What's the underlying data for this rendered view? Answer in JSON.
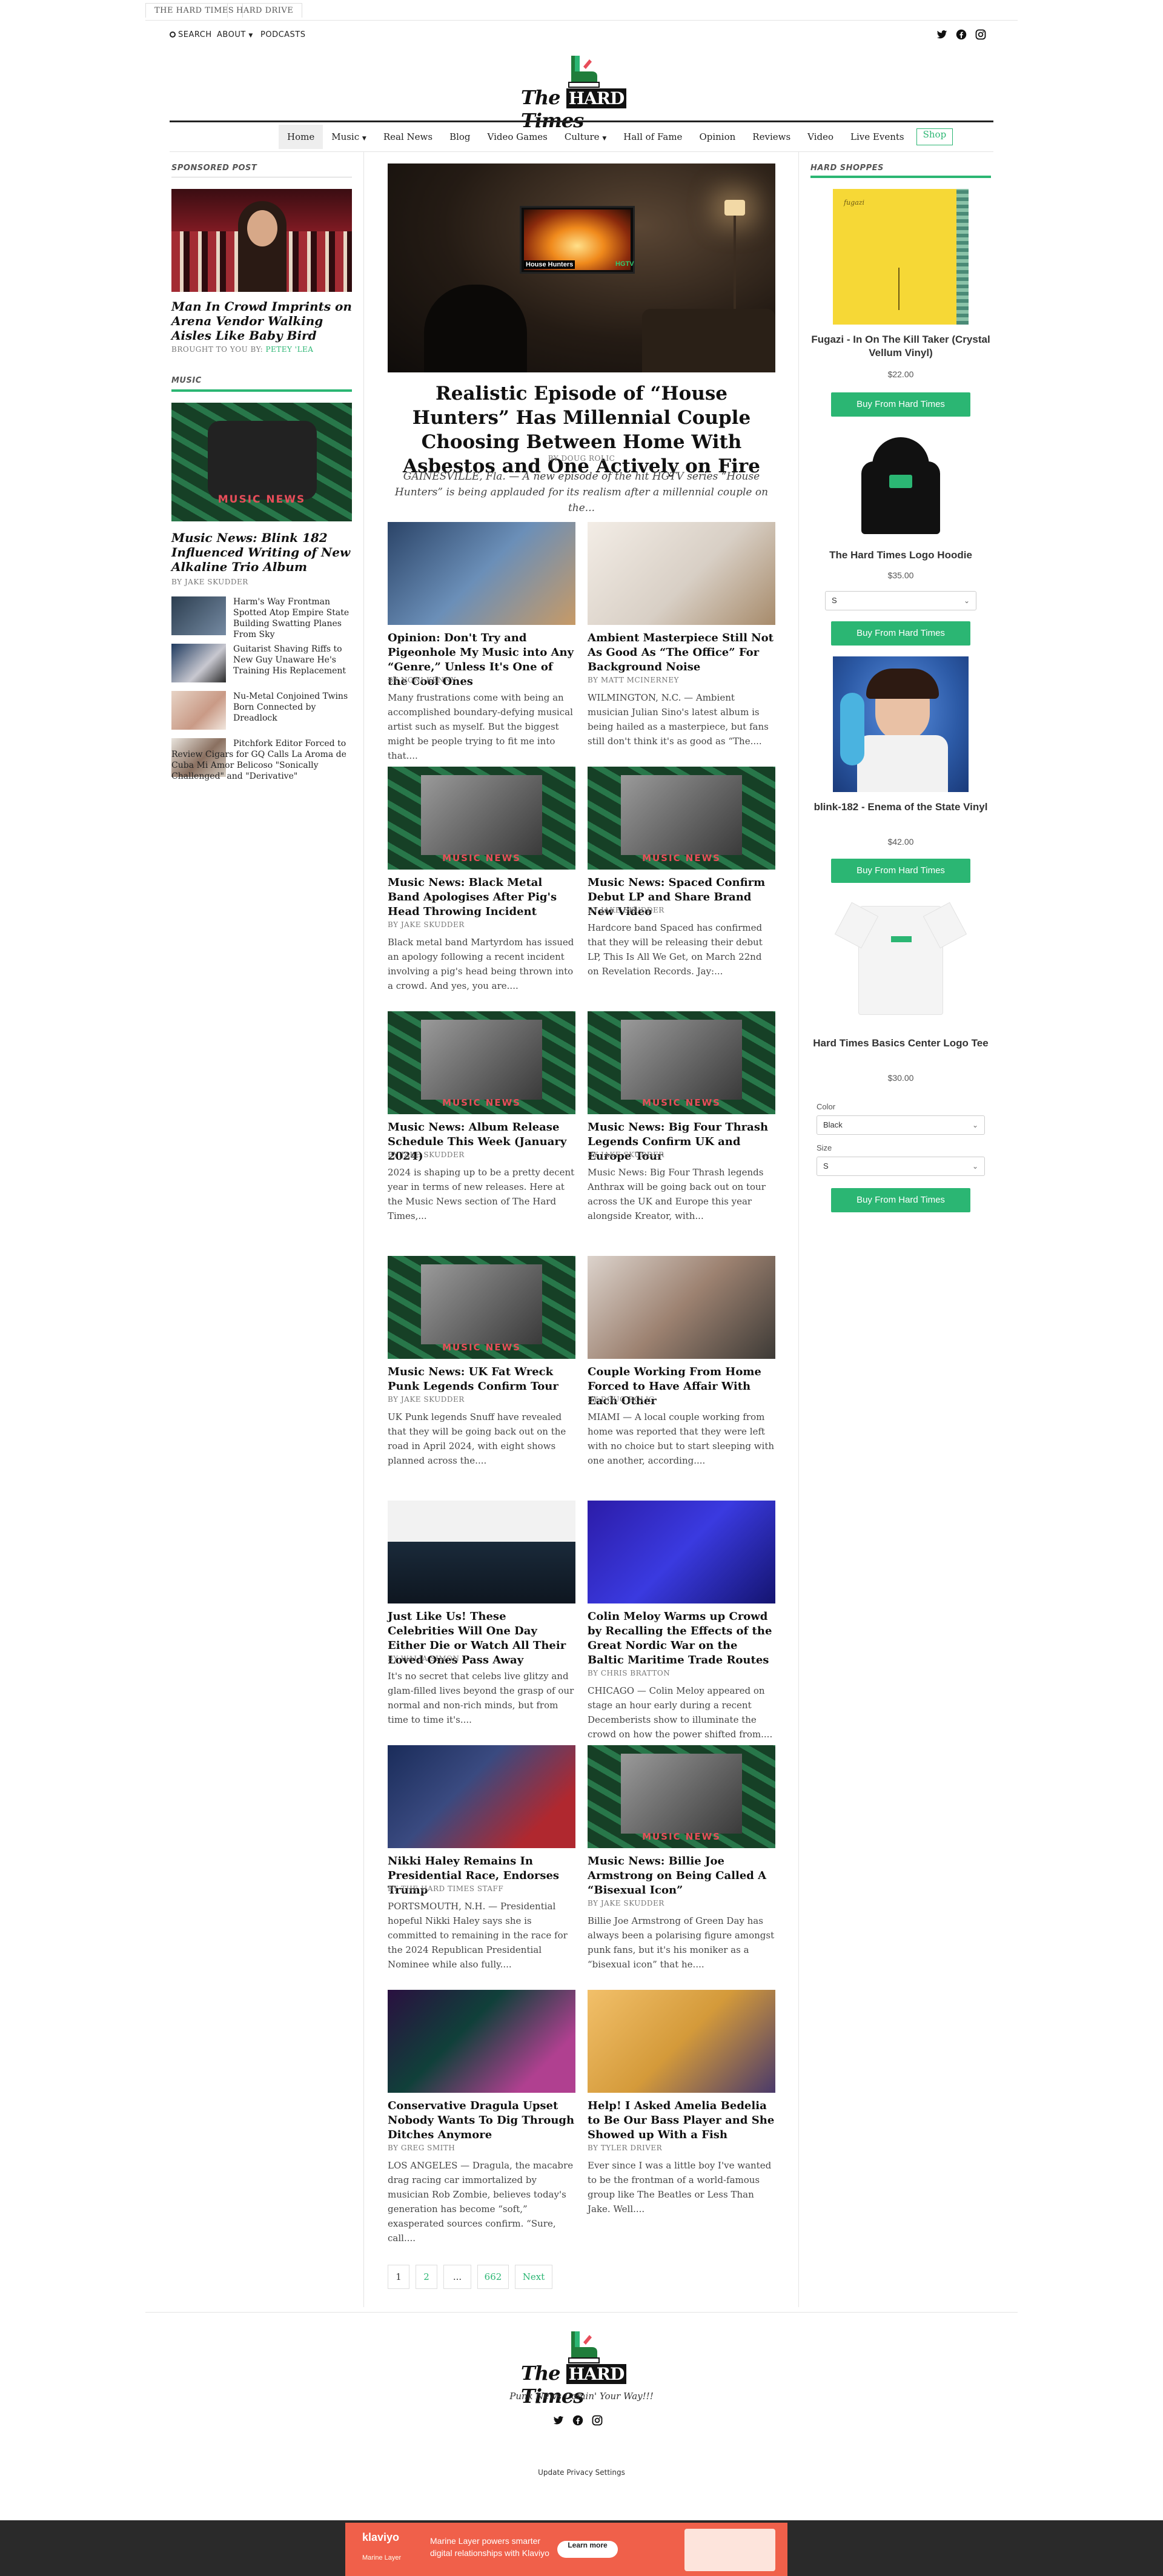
{
  "top_tabs": [
    "THE HARD TIMES",
    "HARD DRIVE"
  ],
  "utility": {
    "search": "SEARCH",
    "about": "ABOUT",
    "podcasts": "PODCASTS"
  },
  "brand": {
    "the": "The",
    "name": "HARD",
    "times": "Times",
    "tagline": "Punk News Comin' Your Way!!!"
  },
  "nav": {
    "items": [
      "Home",
      "Music",
      "Real News",
      "Blog",
      "Video Games",
      "Culture",
      "Hall of Fame",
      "Opinion",
      "Reviews",
      "Video",
      "Live Events"
    ],
    "shop": "Shop"
  },
  "left": {
    "sponsored_label": "SPONSORED POST",
    "sponsored_title": "Man In Crowd Imprints on Arena Vendor Walking Aisles Like Baby Bird",
    "sponsored_by_prefix": "BROUGHT TO YOU BY:",
    "sponsored_by": "PETEY 'LEA",
    "music_label": "MUSIC",
    "music_title": "Music News: Blink 182 Influenced Writing of New Alkaline Trio Album",
    "music_by": "BY JAKE SKUDDER",
    "mini": [
      "Harm's Way Frontman Spotted Atop Empire State Building Swatting Planes From Sky",
      "Guitarist Shaving Riffs to New Guy Unaware He's Training His Replacement",
      "Nu-Metal Conjoined Twins Born Connected by Dreadlock",
      "Pitchfork Editor Forced to Review Cigars for GQ Calls La Aroma de Cuba Mi Amor Belicoso \"Sonically Challenged\" and \"Derivative\""
    ]
  },
  "hero": {
    "title": "Realistic Episode of “House Hunters” Has Millennial Couple Choosing Between Home With Asbestos and One Actively on Fire",
    "by": "BY DOUG ROLIC",
    "excerpt": "GAINESVILLE, Fla. — A new episode of the hit HGTV series “House Hunters” is being applauded for its realism after a millennial couple on the...",
    "tv_label_left": "House Hunters",
    "tv_label_right": "HGTV"
  },
  "articles": [
    {
      "title": "Opinion: Don't Try and Pigeonhole My Music into Any “Genre,” Unless It's One of the Cool Ones",
      "by": "BY NONI KENNY",
      "excerpt": "Many frustrations come with being an accomplished boundary-defying musical artist such as myself. But the biggest might be people trying to fit me into that...."
    },
    {
      "title": "Ambient Masterpiece Still Not As Good As “The Office” For Background Noise",
      "by": "BY MATT MCINERNEY",
      "excerpt": "WILMINGTON, N.C. — Ambient musician Julian Sino's latest album is being hailed as a masterpiece, but fans still don't think it's as good as “The...."
    },
    {
      "title": "Music News: Black Metal Band Apologises After Pig's Head Throwing Incident",
      "by": "BY JAKE SKUDDER",
      "excerpt": "Black metal band Martyrdom has issued an apology following a recent incident involving a pig's head being thrown into a crowd. And yes, you are...."
    },
    {
      "title": "Music News: Spaced Confirm Debut LP and Share Brand New Video",
      "by": "BY JAKE SKUDDER",
      "excerpt": "Hardcore band Spaced has confirmed that they will be releasing their debut LP, This Is All We Get, on March 22nd on Revelation Records. Jay:..."
    },
    {
      "title": "Music News: Album Release Schedule This Week (January 2024)",
      "by": "BY JAKE SKUDDER",
      "excerpt": "2024 is shaping up to be a pretty decent year in terms of new releases. Here at the Music News section of The Hard Times,..."
    },
    {
      "title": "Music News: Big Four Thrash Legends Confirm UK and Europe Tour",
      "by": "BY JAKE SKUDDER",
      "excerpt": "Music News: Big Four Thrash legends Anthrax will be going back out on tour across the UK and Europe this year alongside Kreator, with..."
    },
    {
      "title": "Music News: UK Fat Wreck Punk Legends Confirm Tour",
      "by": "BY JAKE SKUDDER",
      "excerpt": "UK Punk legends Snuff have revealed that they will be going back out on the road in April 2024, with eight shows planned across the...."
    },
    {
      "title": "Couple Working From Home Forced to Have Affair With Each Other",
      "by": "BY DOUG ROLIC",
      "excerpt": "MIAMI — A local couple working from home was reported that they were left with no choice but to start sleeping with one another, according...."
    },
    {
      "title": "Just Like Us! These Celebrities Will One Day Either Die or Watch All Their Loved Ones Pass Away",
      "by": "BY WALIA SIMON",
      "excerpt": "It's no secret that celebs live glitzy and glam-filled lives beyond the grasp of our normal and non-rich minds, but from time to time it's...."
    },
    {
      "title": "Colin Meloy Warms up Crowd by Recalling the Effects of the Great Nordic War on the Baltic Maritime Trade Routes",
      "by": "BY CHRIS BRATTON",
      "excerpt": "CHICAGO — Colin Meloy appeared on stage an hour early during a recent Decemberists show to illuminate the crowd on how the power shifted from...."
    },
    {
      "title": "Nikki Haley Remains In Presidential Race, Endorses Trump",
      "by": "BY THE HARD TIMES STAFF",
      "excerpt": "PORTSMOUTH, N.H. — Presidential hopeful Nikki Haley says she is committed to remaining in the race for the 2024 Republican Presidential Nominee while also fully...."
    },
    {
      "title": "Music News: Billie Joe Armstrong on Being Called A “Bisexual Icon”",
      "by": "BY JAKE SKUDDER",
      "excerpt": "Billie Joe Armstrong of Green Day has always been a polarising figure amongst punk fans, but it's his moniker as a “bisexual icon” that he...."
    },
    {
      "title": "Conservative Dragula Upset Nobody Wants To Dig Through Ditches Anymore",
      "by": "BY GREG SMITH",
      "excerpt": "LOS ANGELES — Dragula, the macabre drag racing car immortalized by musician Rob Zombie, believes today's generation has become “soft,” exasperated sources confirm. “Sure, call...."
    },
    {
      "title": "Help! I Asked Amelia Bedelia to Be Our Bass Player and She Showed up With a Fish",
      "by": "BY TYLER DRIVER",
      "excerpt": "Ever since I was a little boy I've wanted to be the frontman of a world-famous group like The Beatles or Less Than Jake. Well...."
    }
  ],
  "music_news_banner": "MUSIC NEWS",
  "pagination": [
    "1",
    "2",
    "...",
    "662",
    "Next"
  ],
  "shop": {
    "label": "HARD SHOPPES",
    "buy_label": "Buy From Hard Times",
    "products": [
      {
        "name": "Fugazi - In On The Kill Taker (Crystal Vellum Vinyl)",
        "price": "$22.00",
        "art_text": "fugazi"
      },
      {
        "name": "The Hard Times Logo Hoodie",
        "price": "$35.00",
        "size": "S"
      },
      {
        "name": "blink-182 - Enema of the State Vinyl",
        "price": "$42.00"
      },
      {
        "name": "Hard Times Basics Center Logo Tee",
        "price": "$30.00",
        "color_label": "Color",
        "color": "Black",
        "size_label": "Size",
        "size": "S"
      }
    ]
  },
  "footer": {
    "privacy": "Update Privacy Settings"
  },
  "ad": {
    "brand": "klaviyo",
    "sub": "Marine Layer",
    "text1": "Marine Layer powers smarter",
    "text2": "digital relationships with Klaviyo",
    "cta": "Learn more"
  },
  "colors": {
    "accent": "#2bb673",
    "text": "#222222",
    "ad_bg": "#f0604a"
  }
}
